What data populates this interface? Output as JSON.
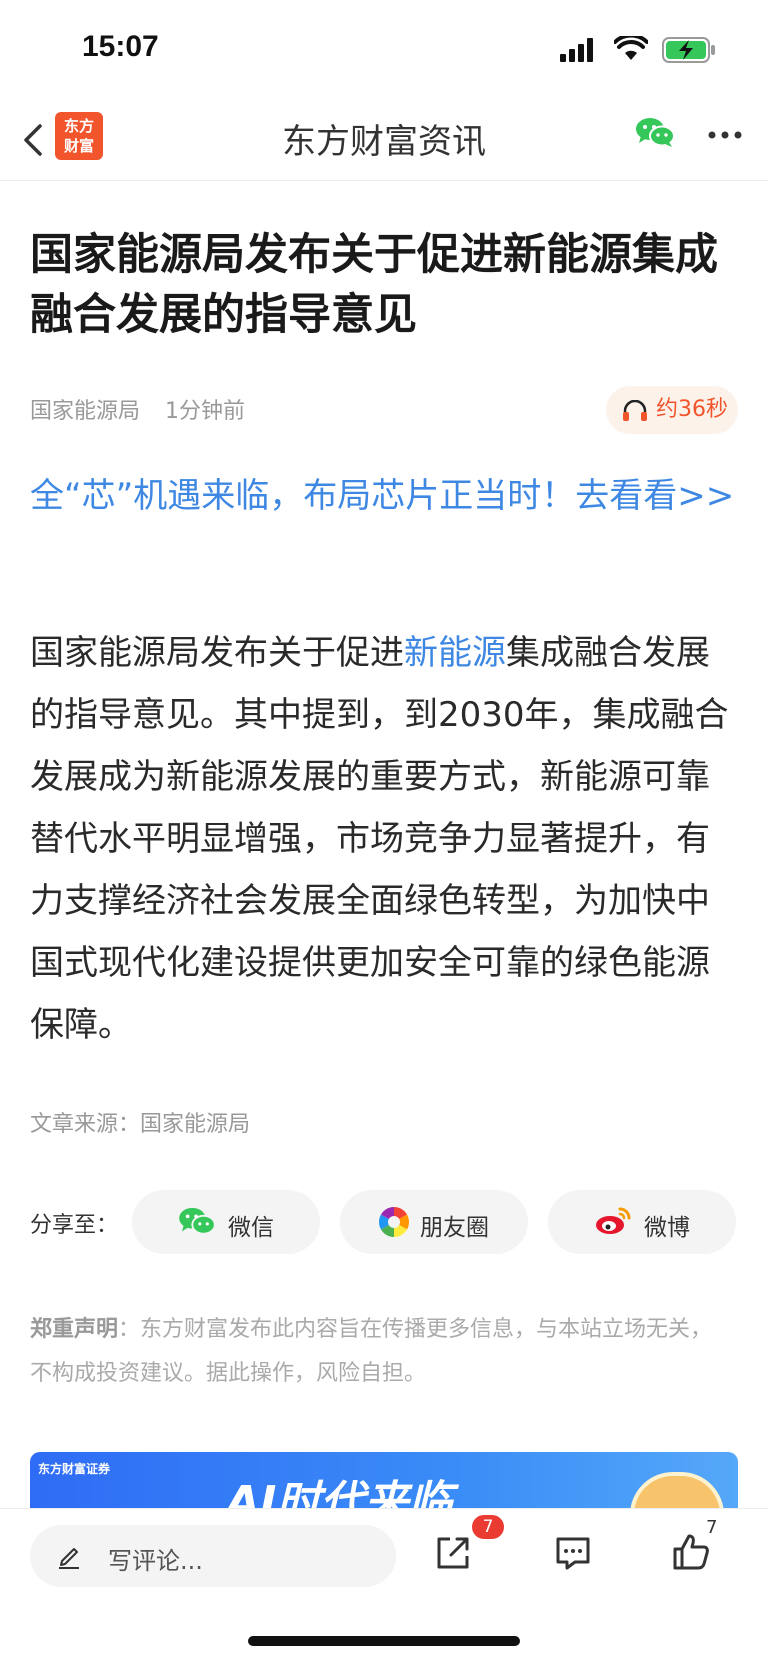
{
  "status_bar": {
    "time": "15:07"
  },
  "nav": {
    "logo_text_line1": "东方",
    "logo_text_line2": "财富",
    "title": "东方财富资讯"
  },
  "article": {
    "title": "国家能源局发布关于促进新能源集成融合发展的指导意见",
    "author": "国家能源局",
    "time": "1分钟前",
    "audio_label": "约36秒",
    "promo": "全“芯”机遇来临，布局芯片正当时！去看看>>",
    "body_before": "国家能源局发布关于促进",
    "body_link": "新能源",
    "body_after": "集成融合发展的指导意见。其中提到，到2030年，集成融合发展成为新能源发展的重要方式，新能源可靠替代水平明显增强，市场竞争力显著提升，有力支撑经济社会发展全面绿色转型，为加快中国式现代化建设提供更加安全可靠的绿色能源保障。",
    "source": "文章来源：国家能源局"
  },
  "share": {
    "label": "分享至：",
    "wechat": "微信",
    "moments": "朋友圈",
    "weibo": "微博"
  },
  "disclaimer": {
    "heading": "郑重声明",
    "text": "：东方财富发布此内容旨在传播更多信息，与本站立场无关，不构成投资建议。据此操作，风险自担。"
  },
  "banner": {
    "brand": "东方财富证券",
    "title": "AI时代来临"
  },
  "bottom_bar": {
    "comment_placeholder": "写评论...",
    "share_badge": "7",
    "like_count": "7"
  },
  "colors": {
    "accent": "#f2552c",
    "link": "#3e88e3",
    "badge": "#ea3b33"
  }
}
